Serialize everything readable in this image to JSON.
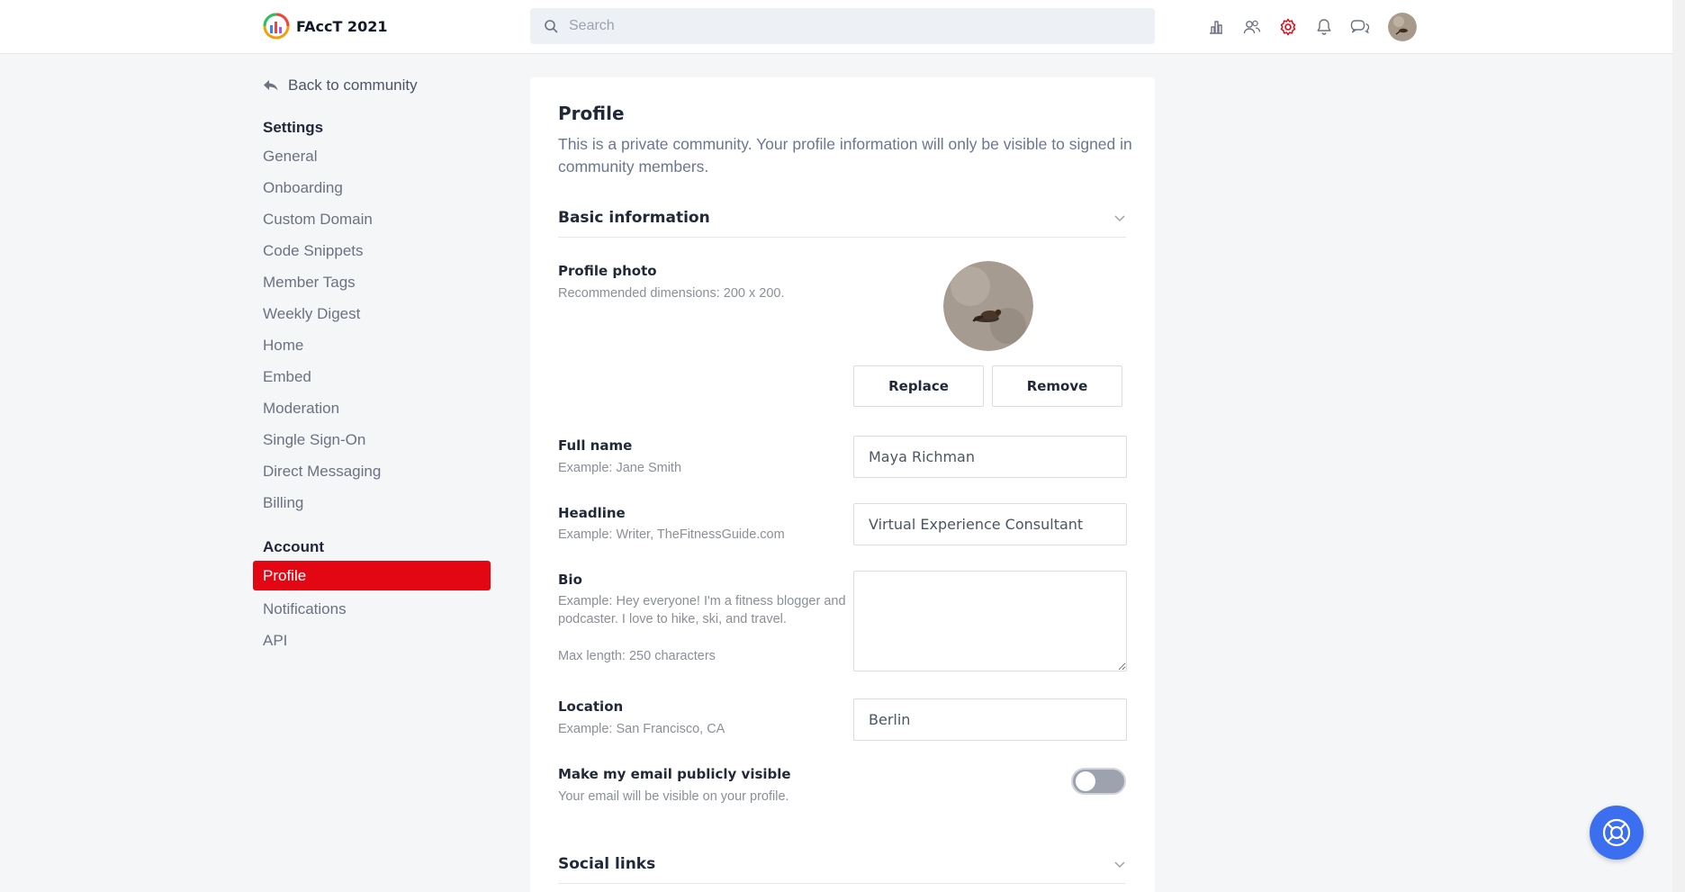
{
  "brand": {
    "name": "FAccT 2021"
  },
  "search": {
    "placeholder": "Search"
  },
  "header_icons": [
    "analytics-icon",
    "members-icon",
    "settings-gear-icon",
    "notifications-bell-icon",
    "messages-icon",
    "user-avatar"
  ],
  "colors": {
    "accent": "#e30613",
    "help_button": "#3b6ff0",
    "muted_text": "#6b7280"
  },
  "sidebar": {
    "back_label": "Back to community",
    "settings_heading": "Settings",
    "settings_items": [
      "General",
      "Onboarding",
      "Custom Domain",
      "Code Snippets",
      "Member Tags",
      "Weekly Digest",
      "Home",
      "Embed",
      "Moderation",
      "Single Sign-On",
      "Direct Messaging",
      "Billing"
    ],
    "account_heading": "Account",
    "account_items": [
      "Profile",
      "Notifications",
      "API"
    ],
    "active_item": "Profile"
  },
  "profile": {
    "title": "Profile",
    "description": "This is a private community. Your profile information will only be visible to signed in community members.",
    "basic_info_heading": "Basic information",
    "photo_label": "Profile photo",
    "photo_help": "Recommended dimensions: 200 x 200.",
    "replace_label": "Replace",
    "remove_label": "Remove",
    "full_name_label": "Full name",
    "full_name_help": "Example: Jane Smith",
    "full_name_value": "Maya Richman",
    "headline_label": "Headline",
    "headline_help": "Example: Writer, TheFitnessGuide.com",
    "headline_value": "Virtual Experience Consultant",
    "bio_label": "Bio",
    "bio_help": "Example: Hey everyone! I'm a fitness blogger and podcaster. I love to hike, ski, and travel.",
    "bio_max": "Max length: 250 characters",
    "bio_value": "",
    "location_label": "Location",
    "location_help": "Example: San Francisco, CA",
    "location_value": "Berlin",
    "email_visible_label": "Make my email publicly visible",
    "email_visible_help": "Your email will be visible on your profile.",
    "email_visible": false,
    "social_links_heading": "Social links"
  }
}
